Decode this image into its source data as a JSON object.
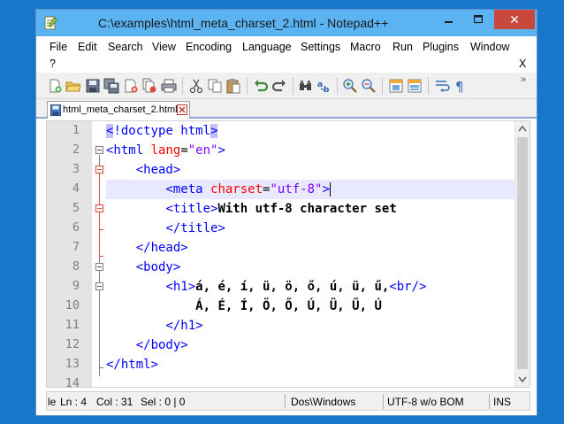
{
  "window": {
    "title": "C:\\examples\\html_meta_charset_2.html - Notepad++",
    "minimize_glyph": "▬",
    "maximize_glyph": "▢",
    "close_glyph": "✕"
  },
  "menu": {
    "items": [
      "File",
      "Edit",
      "Search",
      "View",
      "Encoding",
      "Language",
      "Settings",
      "Macro",
      "Run",
      "Plugins",
      "Window"
    ],
    "help": "?",
    "close_doc": "X"
  },
  "toolbar": {
    "icons": [
      "new-file-icon",
      "open-file-icon",
      "save-icon",
      "save-all-icon",
      "close-icon",
      "close-all-icon",
      "print-icon",
      "cut-icon",
      "copy-icon",
      "paste-icon",
      "undo-icon",
      "redo-icon",
      "find-icon",
      "replace-icon",
      "zoom-in-icon",
      "zoom-out-icon",
      "sync-vertical-icon",
      "sync-horizontal-icon",
      "word-wrap-icon",
      "show-all-characters-icon"
    ],
    "more_glyph": "»"
  },
  "tab": {
    "label": "html_meta_charset_2.html"
  },
  "editor": {
    "line_numbers": [
      "1",
      "2",
      "3",
      "4",
      "5",
      "6",
      "7",
      "8",
      "9",
      "10",
      "11",
      "12",
      "13",
      "14"
    ],
    "lines": {
      "l1": {
        "open": "<",
        "body": "!doctype html",
        "close": ">"
      },
      "l2": {
        "tag": "<html",
        "attr": " lang",
        "eq": "=",
        "val": "\"en\"",
        "end": ">"
      },
      "l3": {
        "indent": "    ",
        "tag": "<head>"
      },
      "l4": {
        "indent": "        ",
        "tag": "<meta",
        "attr": " charset",
        "eq": "=",
        "val": "\"utf-8\"",
        "end": ">"
      },
      "l5": {
        "indent": "        ",
        "tag": "<title>",
        "text": "With utf-8 character set"
      },
      "l6": {
        "indent": "        ",
        "tag": "</title>"
      },
      "l7": {
        "indent": "    ",
        "tag": "</head>"
      },
      "l8": {
        "indent": "    ",
        "tag": "<body>"
      },
      "l9": {
        "indent": "        ",
        "tag": "<h1>",
        "text": "á, é, í, ü, ö, ő, ú, ü, ű,",
        "tag2": "<br/>"
      },
      "l10": {
        "indent": "            ",
        "text": "Á, É, Í, Ö, Ő, Ú, Ü, Ű, Ú"
      },
      "l11": {
        "indent": "        ",
        "tag": "</h1>"
      },
      "l12": {
        "indent": "    ",
        "tag": "</body>"
      },
      "l13": {
        "tag": "</html>"
      }
    }
  },
  "status": {
    "prefix": "le",
    "line": "Ln : 4",
    "col": "Col : 31",
    "sel": "Sel : 0 | 0",
    "eol": "Dos\\Windows",
    "encoding": "UTF-8 w/o BOM",
    "mode": "INS"
  },
  "colors": {
    "tag": "#0000ff",
    "attribute": "#ff0000",
    "value": "#8000ff",
    "text": "#000000",
    "current_line": "#e8e8ff",
    "titlebar": "#5bb3f2",
    "close_button": "#c9483c"
  }
}
